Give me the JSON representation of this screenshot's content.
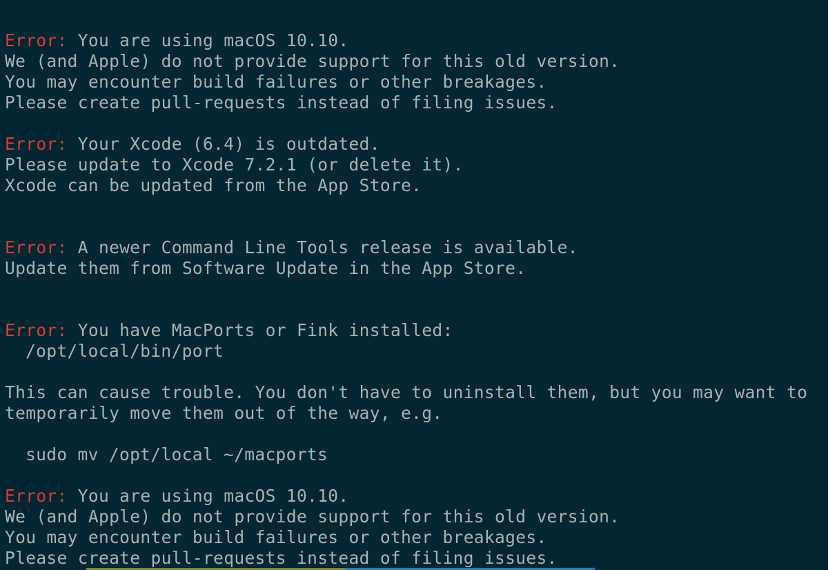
{
  "terminal": {
    "background": "#022632",
    "text_color": "#a7b2b3",
    "error_color": "#db3b35",
    "error_prefix": "Error:",
    "lines": {
      "l0": " You are using macOS 10.10.",
      "l1": "We (and Apple) do not provide support for this old version.",
      "l2": "You may encounter build failures or other breakages.",
      "l3": "Please create pull-requests instead of filing issues.",
      "l5": " Your Xcode (6.4) is outdated.",
      "l6": "Please update to Xcode 7.2.1 (or delete it).",
      "l7": "Xcode can be updated from the App Store.",
      "l10": " A newer Command Line Tools release is available.",
      "l11": "Update them from Software Update in the App Store.",
      "l14": " You have MacPorts or Fink installed:",
      "l15": "/opt/local/bin/port",
      "l17": "This can cause trouble. You don't have to uninstall them, but you may want to",
      "l18": "temporarily move them out of the way, e.g.",
      "l20": "sudo mv /opt/local ~/macports",
      "l22": " You are using macOS 10.10.",
      "l23": "We (and Apple) do not provide support for this old version.",
      "l24": "You may encounter build failures or other breakages.",
      "l25": "Please create pull-requests instead of filing issues."
    },
    "bottom_accent_colors": [
      "#7a8b1f",
      "#1a7fb8"
    ]
  }
}
